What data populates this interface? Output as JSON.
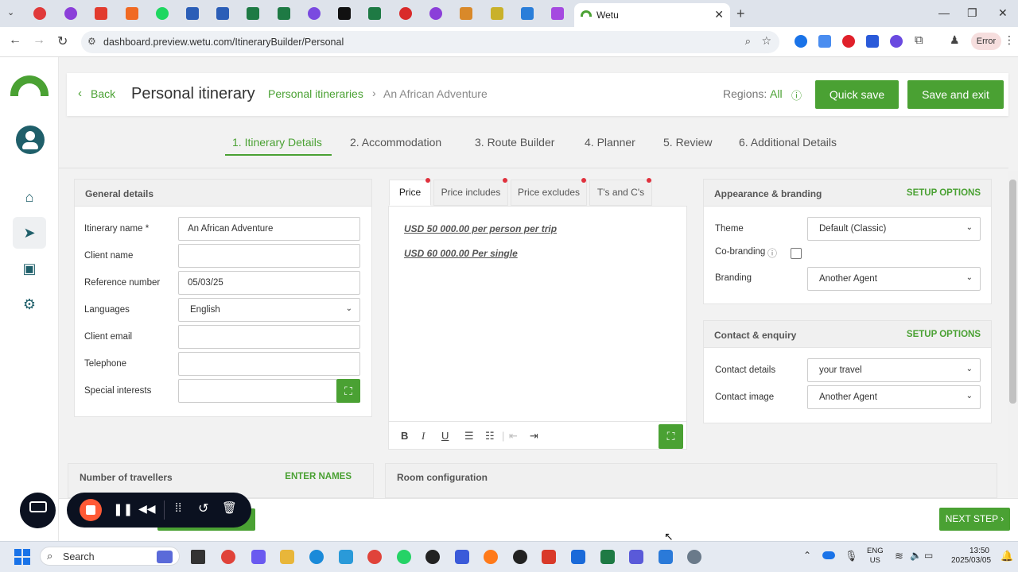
{
  "browser": {
    "active_tab_title": "Wetu",
    "url": "dashboard.preview.wetu.com/ItineraryBuilder/Personal",
    "error_label": "Error"
  },
  "header": {
    "back_label": "Back",
    "title": "Personal itinerary",
    "breadcrumb_link": "Personal itineraries",
    "breadcrumb_current": "An African Adventure",
    "regions_label": "Regions:",
    "regions_value": "All",
    "quick_save_label": "Quick save",
    "save_exit_label": "Save and exit"
  },
  "steps": [
    {
      "label": "1. Itinerary Details"
    },
    {
      "label": "2. Accommodation"
    },
    {
      "label": "3. Route Builder"
    },
    {
      "label": "4. Planner"
    },
    {
      "label": "5. Review"
    },
    {
      "label": "6. Additional Details"
    }
  ],
  "general": {
    "heading": "General details",
    "itinerary_name_label": "Itinerary name *",
    "itinerary_name_value": "An African Adventure",
    "client_name_label": "Client name",
    "reference_label": "Reference number",
    "reference_value": "05/03/25",
    "languages_label": "Languages",
    "languages_value": "English",
    "client_email_label": "Client email",
    "telephone_label": "Telephone",
    "special_interests_label": "Special interests"
  },
  "price_panel": {
    "tabs": [
      {
        "label": "Price"
      },
      {
        "label": "Price includes"
      },
      {
        "label": "Price excludes"
      },
      {
        "label": "T's and C's"
      }
    ],
    "line1": "USD 50 000.00 per person per trip",
    "line2": "USD 60 000.00 Per single"
  },
  "appearance": {
    "heading": "Appearance & branding",
    "setup": "SETUP OPTIONS",
    "theme_label": "Theme",
    "theme_value": "Default (Classic)",
    "cobranding_label": "Co-branding",
    "branding_label": "Branding",
    "branding_value": "Another Agent"
  },
  "contact": {
    "heading": "Contact & enquiry",
    "setup": "SETUP OPTIONS",
    "details_label": "Contact details",
    "details_value": "your travel",
    "image_label": "Contact image",
    "image_value": "Another Agent"
  },
  "travellers": {
    "heading": "Number of travellers",
    "enter_names": "ENTER NAMES"
  },
  "rooms": {
    "heading": "Room configuration"
  },
  "next_step_label": "NEXT STEP",
  "taskbar": {
    "search_label": "Search",
    "lang_line1": "ENG",
    "lang_line2": "US",
    "time": "13:50",
    "date": "2025/03/05"
  },
  "colors": {
    "brand_green": "#4aa133",
    "dark_teal": "#1f5f6a"
  }
}
